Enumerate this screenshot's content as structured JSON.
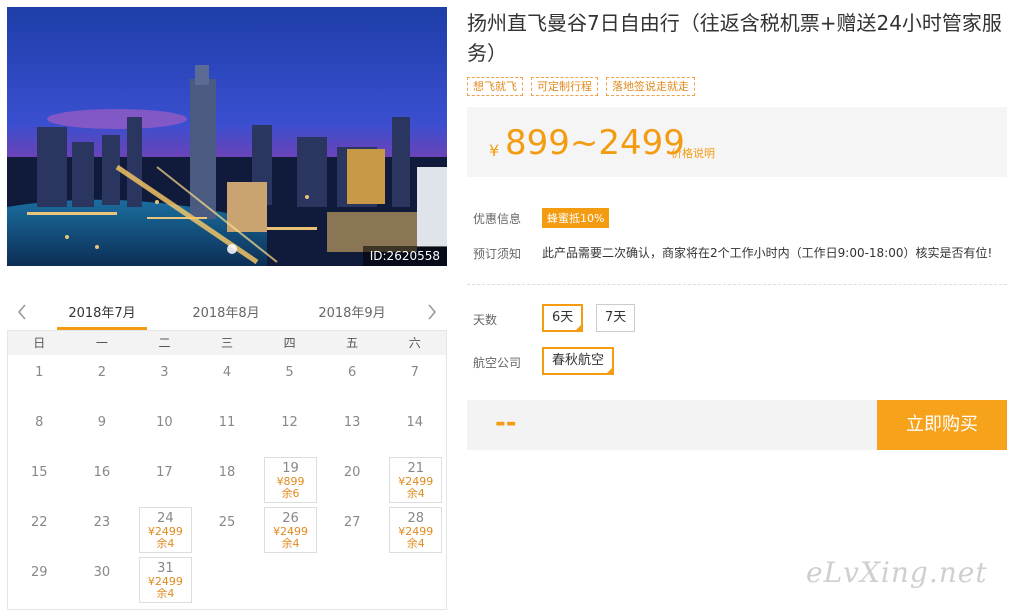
{
  "photo": {
    "id_label": "ID:2620558"
  },
  "calendar": {
    "tabs": [
      "2018年7月",
      "2018年8月",
      "2018年9月"
    ],
    "weekdays": [
      "日",
      "一",
      "二",
      "三",
      "四",
      "五",
      "六"
    ],
    "days": [
      {
        "d": "1"
      },
      {
        "d": "2"
      },
      {
        "d": "3"
      },
      {
        "d": "4"
      },
      {
        "d": "5"
      },
      {
        "d": "6"
      },
      {
        "d": "7"
      },
      {
        "d": "8"
      },
      {
        "d": "9"
      },
      {
        "d": "10"
      },
      {
        "d": "11"
      },
      {
        "d": "12"
      },
      {
        "d": "13"
      },
      {
        "d": "14"
      },
      {
        "d": "15"
      },
      {
        "d": "16"
      },
      {
        "d": "17"
      },
      {
        "d": "18"
      },
      {
        "d": "19",
        "price": "¥899",
        "stock": "余6"
      },
      {
        "d": "20"
      },
      {
        "d": "21",
        "price": "¥2499",
        "stock": "余4"
      },
      {
        "d": "22"
      },
      {
        "d": "23"
      },
      {
        "d": "24",
        "price": "¥2499",
        "stock": "余4"
      },
      {
        "d": "25"
      },
      {
        "d": "26",
        "price": "¥2499",
        "stock": "余4"
      },
      {
        "d": "27"
      },
      {
        "d": "28",
        "price": "¥2499",
        "stock": "余4"
      },
      {
        "d": "29"
      },
      {
        "d": "30"
      },
      {
        "d": "31",
        "price": "¥2499",
        "stock": "余4"
      }
    ]
  },
  "product": {
    "title": "扬州直飞曼谷7日自由行（往返含税机票+赠送24小时管家服务）",
    "tags": [
      "想飞就飞",
      "可定制行程",
      "落地签说走就走"
    ],
    "price_symbol": "¥",
    "price_range": "899~2499",
    "price_note": "价格说明"
  },
  "info": {
    "discount_label": "优惠信息",
    "discount_value": "蜂蜜抵10%",
    "notice_label": "预订须知",
    "notice_value": "此产品需要二次确认，商家将在2个工作小时内（工作日9:00-18:00）核实是否有位!"
  },
  "options": {
    "days_label": "天数",
    "days": [
      "6天",
      "7天"
    ],
    "airline_label": "航空公司",
    "airlines": [
      "春秋航空"
    ]
  },
  "buy": {
    "placeholder": "--",
    "button": "立即购买"
  },
  "watermark": "eLvXing.net"
}
